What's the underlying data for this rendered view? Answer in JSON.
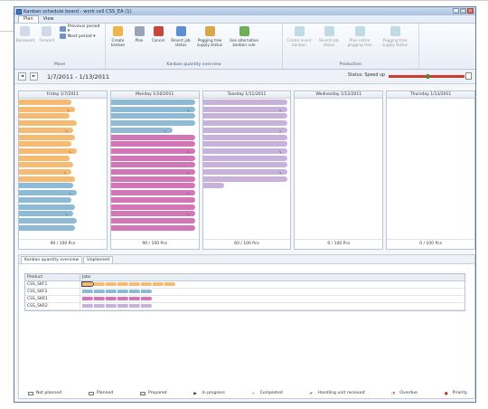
{
  "window": {
    "title": "Kanban schedule board - work cell CSS_EA (1)",
    "controls": [
      "_",
      "□",
      "×"
    ]
  },
  "menu_tabs": [
    {
      "label": "Plan",
      "active": true
    },
    {
      "label": "View",
      "active": false
    }
  ],
  "ribbon": {
    "move": {
      "label": "Move",
      "backward": "Backward",
      "forward": "Forward",
      "previous": "Previous period ▾",
      "next": "Next period ▾"
    },
    "kanban": {
      "label": "Kanban quantity overview",
      "buttons": [
        "Create kanban",
        "Plan",
        "Cancel",
        "Revert job status",
        "Pegging tree supply status",
        "Use alternative kanban rule"
      ]
    },
    "production": {
      "label": "Production",
      "buttons": [
        "Create event kanban",
        "Revert job status",
        "Plan entire pegging tree",
        "Pegging tree supply status"
      ]
    }
  },
  "datebar": {
    "prev": "◄",
    "next": "►",
    "range": "1/7/2011 - 1/13/2011",
    "status": "Status: Speed up"
  },
  "days": [
    {
      "name": "Friday 1/7/2011",
      "summary": "90 / 100 Pcs",
      "bars": [
        [
          "orange",
          60
        ],
        [
          "orange",
          64
        ],
        [
          "orange",
          58
        ],
        [
          "orange",
          66
        ],
        [
          "orange",
          62
        ],
        [
          "orange",
          64
        ],
        [
          "orange",
          60
        ],
        [
          "orange",
          66
        ],
        [
          "orange",
          58
        ],
        [
          "orange",
          62
        ],
        [
          "orange",
          60
        ],
        [
          "orange",
          64
        ],
        [
          "blue",
          62
        ],
        [
          "blue",
          66
        ],
        [
          "blue",
          60
        ],
        [
          "blue",
          64
        ],
        [
          "blue",
          62
        ],
        [
          "blue",
          66
        ],
        [
          "blue",
          64
        ]
      ]
    },
    {
      "name": "Monday 1/10/2011",
      "summary": "90 / 100 Pcs",
      "bars": [
        [
          "blue",
          96
        ],
        [
          "blue",
          96
        ],
        [
          "blue",
          96
        ],
        [
          "blue",
          96
        ],
        [
          "blue",
          70
        ],
        [
          "pink",
          96
        ],
        [
          "pink",
          96
        ],
        [
          "pink",
          96
        ],
        [
          "pink",
          96
        ],
        [
          "pink",
          96
        ],
        [
          "pink",
          96
        ],
        [
          "pink",
          96
        ],
        [
          "pink",
          96
        ],
        [
          "pink",
          96
        ],
        [
          "pink",
          96
        ],
        [
          "pink",
          96
        ],
        [
          "pink",
          96
        ],
        [
          "pink",
          96
        ],
        [
          "pink",
          96
        ]
      ]
    },
    {
      "name": "Tuesday 1/11/2011",
      "summary": "60 / 100 Pcs",
      "bars": [
        [
          "lilac",
          96
        ],
        [
          "lilac",
          96
        ],
        [
          "lilac",
          96
        ],
        [
          "lilac",
          96
        ],
        [
          "lilac",
          96
        ],
        [
          "lilac",
          96
        ],
        [
          "lilac",
          96
        ],
        [
          "lilac",
          96
        ],
        [
          "lilac",
          96
        ],
        [
          "lilac",
          96
        ],
        [
          "lilac",
          96
        ],
        [
          "lilac",
          96
        ],
        [
          "lilac",
          24
        ]
      ]
    },
    {
      "name": "Wednesday 1/12/2011",
      "summary": "0 / 100 Pcs",
      "bars": []
    },
    {
      "name": "Thursday 1/13/2011",
      "summary": "0 / 100 Pcs",
      "bars": []
    }
  ],
  "lower": {
    "tabs": [
      {
        "label": "Kanban quantity overview",
        "active": true
      },
      {
        "label": "Unplanned",
        "active": false
      }
    ],
    "headers": [
      "Product",
      "Jobs"
    ],
    "rows": [
      {
        "product": "CSS_SKF1",
        "jobs": [
          "orange",
          "orange",
          "orange",
          "orange",
          "orange",
          "orange",
          "orange",
          "orange"
        ]
      },
      {
        "product": "CSS_SKF2",
        "jobs": [
          "blue",
          "blue",
          "blue",
          "blue",
          "blue",
          "blue"
        ]
      },
      {
        "product": "CSS_SKR1",
        "jobs": [
          "pink",
          "pink",
          "pink",
          "pink",
          "pink",
          "pink"
        ]
      },
      {
        "product": "CSS_SKR2",
        "jobs": [
          "lilac",
          "lilac",
          "lilac",
          "lilac",
          "lilac",
          "lilac"
        ]
      }
    ]
  },
  "legend": [
    "Not planned",
    "Planned",
    "Prepared",
    "In progress",
    "Completed",
    "Handling unit received",
    "Overdue",
    "Priority"
  ],
  "colors": {
    "orange": "#f5bb72",
    "blue": "#8dbbd6",
    "pink": "#d376b8",
    "lilac": "#c8b2da"
  }
}
